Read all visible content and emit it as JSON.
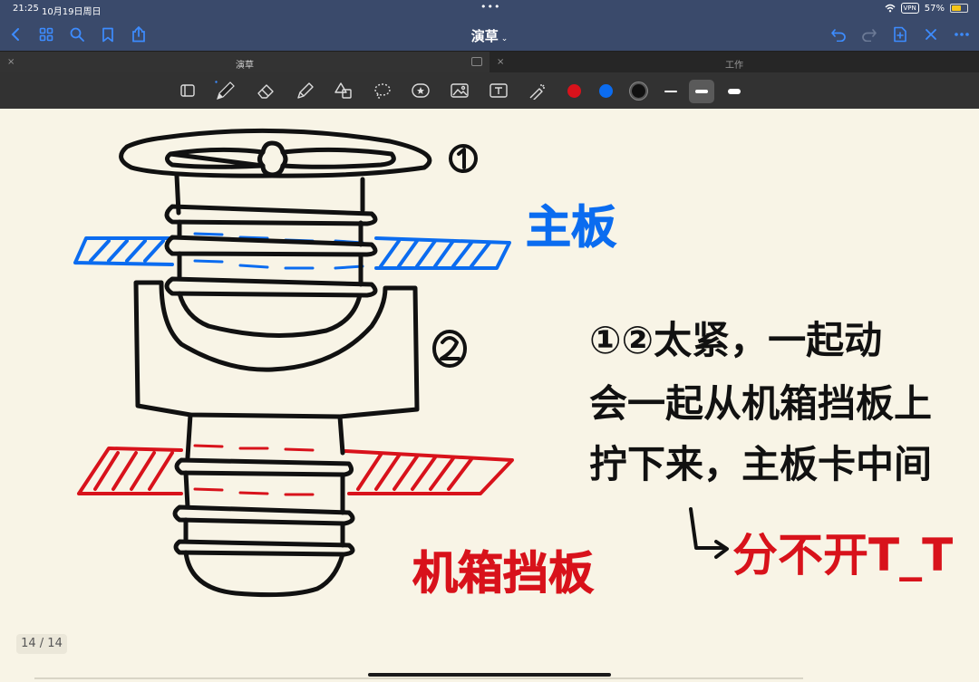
{
  "status_bar": {
    "time": "21:25",
    "date": "10月19日周日",
    "dots": "•••",
    "vpn": "VPN",
    "battery": "57%"
  },
  "nav_bar": {
    "title": "演草",
    "title_chevron": "⌄",
    "left_icons": [
      "back-icon",
      "grid-icon",
      "search-icon",
      "bookmark-icon",
      "share-icon"
    ],
    "right_icons": [
      "undo-icon",
      "redo-icon",
      "add-page-icon",
      "close-icon",
      "more-icon"
    ]
  },
  "tabs": [
    {
      "label": "演草",
      "close": "×",
      "active": true
    },
    {
      "label": "工作",
      "close": "×",
      "active": false
    }
  ],
  "toolbar": {
    "tools": [
      "reader-icon",
      "pen-icon",
      "eraser-icon",
      "highlighter-icon",
      "shapes-icon",
      "lasso-icon",
      "sticker-icon",
      "image-icon",
      "text-icon",
      "laser-icon"
    ],
    "colors": [
      "#d8121b",
      "#0b6cf0",
      "#111111"
    ],
    "selected_color": "#111111",
    "stroke_widths": [
      "thin",
      "medium",
      "thick"
    ],
    "selected_stroke": "medium"
  },
  "canvas": {
    "label_1": "①",
    "label_2": "②",
    "motherboard_label": "主板",
    "case_plate_label": "机箱挡板",
    "note_line_1": "①②太紧，一起动",
    "note_line_2": "会一起从机箱挡板上",
    "note_line_3": "拧下来，主板卡中间",
    "note_line_4": "分不开T_T",
    "arrow": "↳",
    "colors": {
      "ink": "#111111",
      "blue": "#0b6cf0",
      "red": "#d8121b"
    }
  },
  "page_indicator": "14 / 14"
}
